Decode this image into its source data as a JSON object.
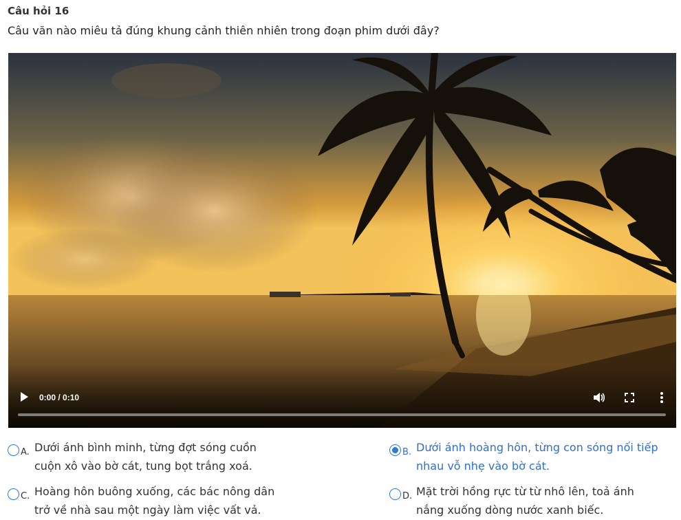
{
  "question": {
    "title": "Câu hỏi 16",
    "text": "Câu văn nào miêu tả đúng khung cảnh thiên nhiên trong đoạn phim dưới đây?"
  },
  "video": {
    "time": "0:00 / 0:10",
    "progress": 0,
    "icons": {
      "play": "play-icon",
      "volume": "volume-icon",
      "fullscreen": "fullscreen-icon",
      "more": "more-vertical-icon"
    }
  },
  "options": [
    {
      "letter": "A.",
      "line1": "Dưới ánh bình minh, từng đợt sóng cuồn",
      "line2": "cuộn xô vào bờ cát, tung bọt trắng xoá.",
      "selected": false
    },
    {
      "letter": "B.",
      "line1": "Dưới ánh hoàng hôn, từng con sóng nối tiếp",
      "line2": "nhau vỗ nhẹ vào bờ cát.",
      "selected": true
    },
    {
      "letter": "C.",
      "line1": "Hoàng hôn buông xuống, các bác nông dân",
      "line2": "trở về nhà sau một ngày làm việc vất vả.",
      "selected": false
    },
    {
      "letter": "D.",
      "line1": "Mặt trời hồng rực từ từ nhô lên, toả ánh",
      "line2": "nắng xuống dòng nước xanh biếc.",
      "selected": false
    }
  ],
  "colors": {
    "accent": "#2f78d6",
    "selected_text": "#2f6fd1"
  }
}
